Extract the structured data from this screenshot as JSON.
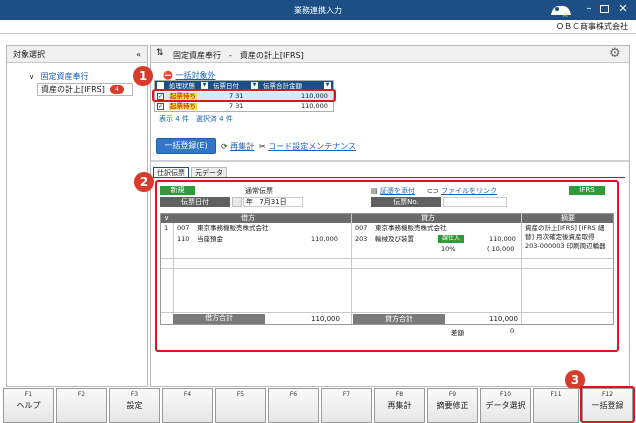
{
  "window": {
    "title": "業務連携入力",
    "company": "ＯＢＣ商事株式会社"
  },
  "left": {
    "header": "対象選択",
    "tree": [
      {
        "label": "固定資産奉行"
      },
      {
        "label": "資産の計上[IFRS]",
        "count": "4"
      }
    ]
  },
  "main": {
    "breadcrumb": "固定資産奉行　-　資産の計上[IFRS]",
    "exclude_label": "一括対象外",
    "list": {
      "headers": [
        "処理状態",
        "伝票日付",
        "伝票合計金額"
      ],
      "rows": [
        {
          "status": "起票待ち",
          "date": "7 31",
          "amount": "110,000"
        },
        {
          "status": "起票待ち",
          "date": "7 31",
          "amount": "110,000"
        }
      ],
      "summary": "表示 4 件　選択済 4 件"
    },
    "actions": {
      "bulk": "一括登録(E)",
      "recalc": "再集計",
      "code_setting": "コード設定メンテナンス"
    },
    "tabs": [
      "仕訳伝票",
      "元データ"
    ],
    "voucher": {
      "new_label": "新規",
      "type": "通常伝票",
      "attach": "証憑を添付",
      "link": "ファイルをリンク",
      "ifrs": "IFRS",
      "date_label": "伝票日付",
      "date_era": "年",
      "date_value": "7月31日",
      "no_label": "伝票No.",
      "col_debit": "借方",
      "col_credit": "貸方",
      "col_summary": "摘要",
      "row": {
        "no": "1",
        "debit_sub1_code": "007",
        "debit_sub1": "東京事務機販売株式会社",
        "debit_code": "110",
        "debit_name": "当座預金",
        "debit_amount": "110,000",
        "credit_sub1_code": "007",
        "credit_sub1": "東京事務機販売株式会社",
        "credit_code": "203",
        "credit_name": "輸械及び装置",
        "credit_tax_tag": "課仕入",
        "credit_rate": "10%",
        "credit_amount": "110,000",
        "credit_tax": "( 10,000",
        "summary": "資産の計上[IFRS] [IFRS 細替] 月次確定後資産取得 203-000003 印刷周辺輪器"
      },
      "total_debit_label": "借方合計",
      "total_debit": "110,000",
      "total_credit_label": "貸方合計",
      "total_credit": "110,000",
      "diff_label": "差額",
      "diff": "0"
    }
  },
  "fkeys": [
    {
      "k": "F1",
      "l": "ヘルプ"
    },
    {
      "k": "F2",
      "l": ""
    },
    {
      "k": "F3",
      "l": "設定"
    },
    {
      "k": "F4",
      "l": ""
    },
    {
      "k": "F5",
      "l": ""
    },
    {
      "k": "F6",
      "l": ""
    },
    {
      "k": "F7",
      "l": ""
    },
    {
      "k": "F8",
      "l": "再集計"
    },
    {
      "k": "F9",
      "l": "摘要修正"
    },
    {
      "k": "F10",
      "l": "データ選択"
    },
    {
      "k": "F11",
      "l": ""
    },
    {
      "k": "F12",
      "l": "一括登録"
    }
  ],
  "callouts": [
    "1",
    "2",
    "3"
  ]
}
